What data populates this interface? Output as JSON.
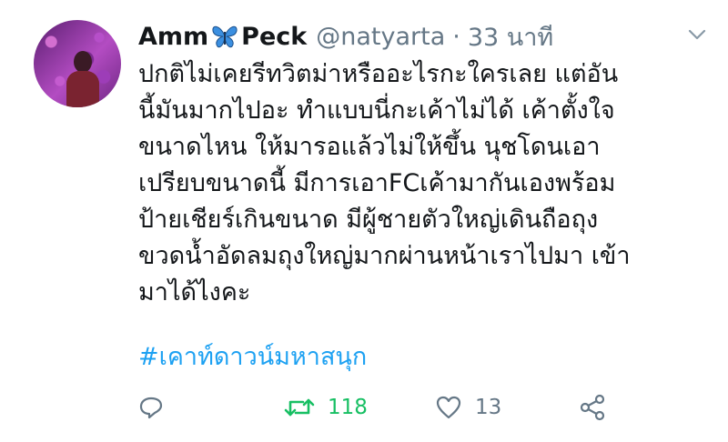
{
  "tweet": {
    "display_name_part1": "Amm",
    "display_name_emoji": "butterfly-icon",
    "display_name_part2": "Peck",
    "handle": "@natyarta",
    "separator": "·",
    "time": "33 นาที",
    "body_lines": [
      "ปกติไม่เคยรีทวิตม่าหรืออะไรกะใครเลย แต่อัน",
      "นี้มันมากไปอะ ทำแบบนี่กะเค้าไม่ได้ เค้าตั้งใจ",
      "ขนาดไหน ให้มารอแล้วไม่ให้ขึ้น นุชโดนเอา",
      "เปรียบขนาดนี้ มีการเอาFCเค้ามากันเองพร้อม",
      "ป้ายเชียร์เกินขนาด มีผู้ชายตัวใหญ่เดินถือถุง",
      "ขวดน้ำอัดลมถุงใหญ่มากผ่านหน้าเราไปมา เข้า",
      "มาได้ไงคะ"
    ],
    "hashtag": "#เคาท์ดาวน์มหาสนุก"
  },
  "actions": {
    "reply_icon": "reply-icon",
    "retweet_icon": "retweet-icon",
    "retweet_count": "118",
    "like_icon": "heart-icon",
    "like_count": "13",
    "share_icon": "share-icon"
  },
  "colors": {
    "text": "#14171a",
    "secondary": "#657786",
    "link": "#1da1f2",
    "retweet": "#17bf63",
    "butterfly": "#3b8fe0"
  }
}
